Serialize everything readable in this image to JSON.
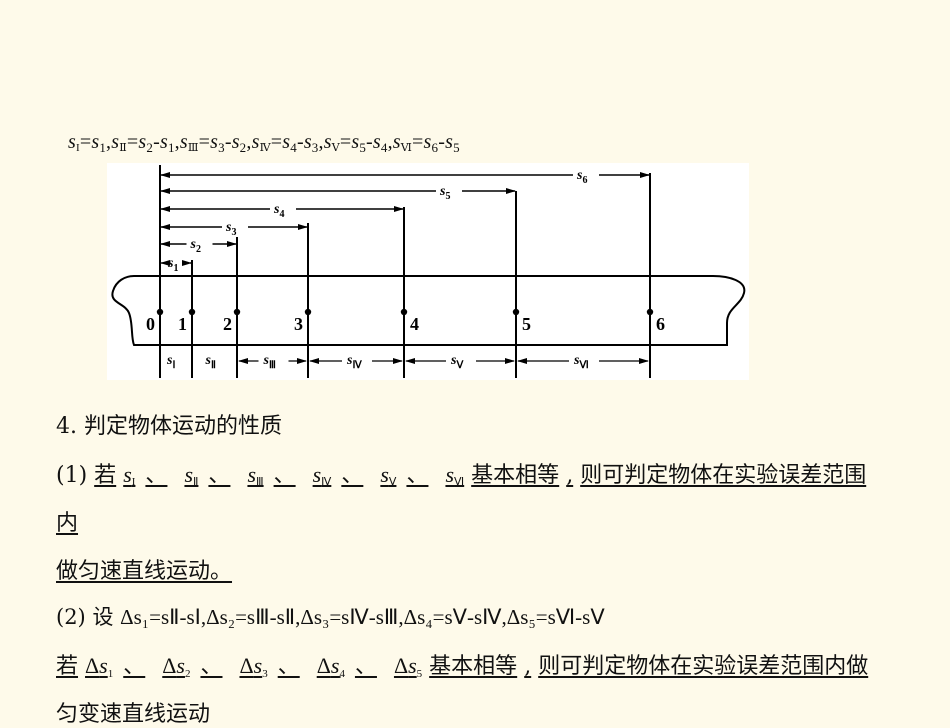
{
  "formula": {
    "parts": [
      {
        "lhs": "I",
        "rhs": "s1"
      },
      {
        "lhs": "II",
        "rhs": "s2-s1"
      },
      {
        "lhs": "III",
        "rhs": "s3-s2"
      },
      {
        "lhs": "IV",
        "rhs": "s4-s3"
      },
      {
        "lhs": "V",
        "rhs": "s5-s4"
      },
      {
        "lhs": "VI",
        "rhs": "s6-s5"
      }
    ],
    "s": "s",
    "eq": "=",
    "comma": ",",
    "minus": "-",
    "i1": "1",
    "i2": "2",
    "i3": "3",
    "i4": "4",
    "i5": "5",
    "i6": "6",
    "rI": "I",
    "rII": "Ⅱ",
    "rIII": "Ⅲ",
    "rIV": "Ⅳ",
    "rV": "Ⅴ",
    "rVI": "Ⅵ"
  },
  "diagram": {
    "points": [
      "0",
      "1",
      "2",
      "3",
      "4",
      "5",
      "6"
    ],
    "cumulative_labels": [
      "s1",
      "s2",
      "s3",
      "s4",
      "s5",
      "s6"
    ],
    "segment_labels": [
      "sⅠ",
      "sⅡ",
      "sⅢ",
      "sⅣ",
      "sⅤ",
      "sⅥ"
    ]
  },
  "section": {
    "heading": "4. 判定物体运动的性质",
    "item1": {
      "prefix": "(1)",
      "ruo": "若",
      "sep": "、",
      "basic_equal": "基本相等",
      "comma": ",",
      "conclusion_line1": "则可判定物体在实验误差范围",
      "conclusion_wrap": "内",
      "conclusion_line2": "做匀速直线运动。"
    },
    "item2": {
      "prefix": "(2)",
      "she": "设",
      "defs": "Δs₁=sⅡ-sⅠ,Δs₂=sⅢ-sⅡ,Δs₃=sⅣ-sⅢ,Δs₄=sⅤ-sⅣ,Δs₅=sⅥ-sⅤ",
      "ruo": "若",
      "delta": "Δs",
      "sep": "、",
      "basic_equal": "基本相等",
      "comma": ",",
      "conclusion_line1": "则可判定物体在实验误差范围内做",
      "conclusion_line2": "匀变速直线运动"
    }
  }
}
